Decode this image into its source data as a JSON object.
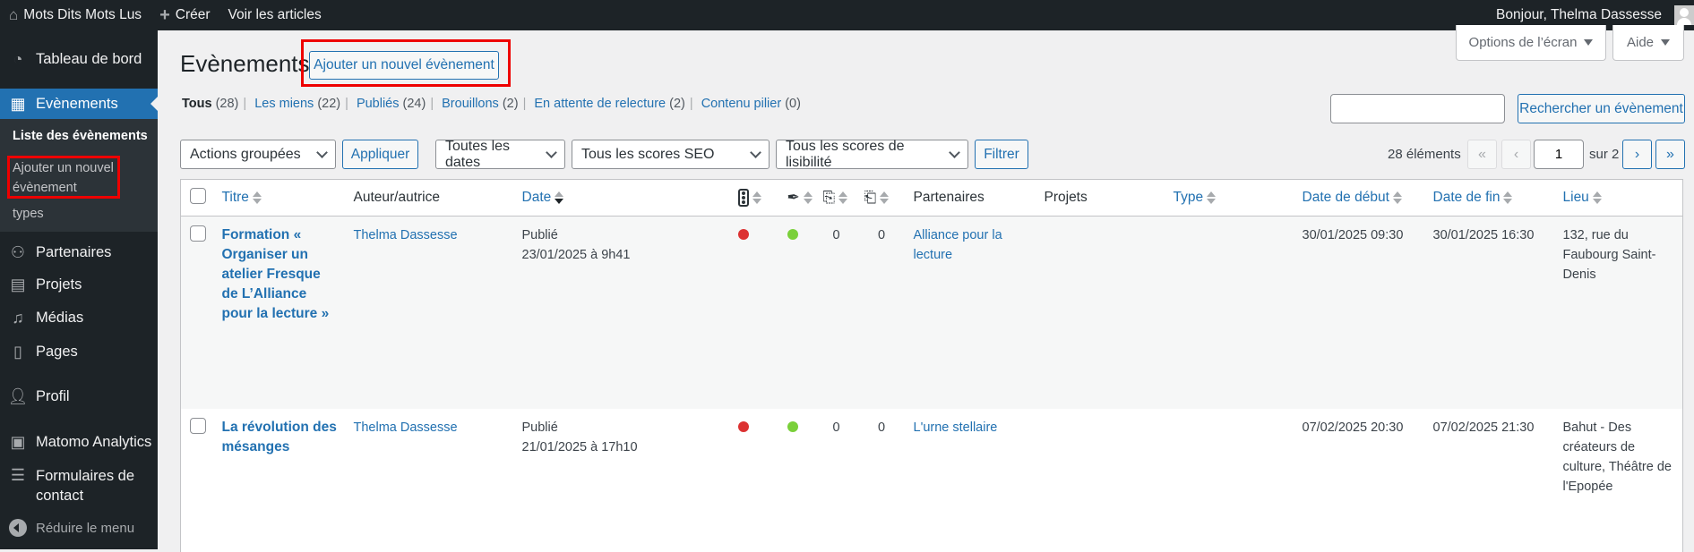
{
  "adminbar": {
    "site_name": "Mots Dits Mots Lus",
    "create": "Créer",
    "view_posts": "Voir les articles",
    "greeting": "Bonjour, Thelma Dassesse"
  },
  "sidebar": {
    "items": [
      {
        "label": "Tableau de bord",
        "icon": "dashboard-icon"
      },
      {
        "label": "Evènements",
        "icon": "calendar-icon",
        "active": true
      },
      {
        "label": "Partenaires",
        "icon": "sitemap-icon"
      },
      {
        "label": "Projets",
        "icon": "grid-icon"
      },
      {
        "label": "Médias",
        "icon": "media-icon"
      },
      {
        "label": "Pages",
        "icon": "pages-icon"
      },
      {
        "label": "Profil",
        "icon": "user-icon"
      },
      {
        "label": "Matomo Analytics",
        "icon": "analytics-icon"
      },
      {
        "label": "Formulaires de contact",
        "icon": "forms-icon"
      }
    ],
    "submenu": [
      "Liste des évènements",
      "Ajouter un nouvel évènement",
      "types"
    ],
    "collapse": "Réduire le menu"
  },
  "screen_options": "Options de l’écran",
  "help": "Aide",
  "page_title": "Evènements",
  "add_new": "Ajouter un nouvel évènement",
  "views": [
    {
      "label": "Tous",
      "count": "(28)",
      "current": true
    },
    {
      "label": "Les miens",
      "count": "(22)"
    },
    {
      "label": "Publiés",
      "count": "(24)"
    },
    {
      "label": "Brouillons",
      "count": "(2)"
    },
    {
      "label": "En attente de relecture",
      "count": "(2)"
    },
    {
      "label": "Contenu pilier",
      "count": "(0)"
    }
  ],
  "search": {
    "value": "",
    "button": "Rechercher un évènement"
  },
  "filters": {
    "bulk": "Actions groupées",
    "apply": "Appliquer",
    "dates": "Toutes les dates",
    "seo": "Tous les scores SEO",
    "readability": "Tous les scores de lisibilité",
    "filter": "Filtrer"
  },
  "pagination": {
    "count": "28 éléments",
    "first": "«",
    "prev": "‹",
    "page": "1",
    "of": "sur 2",
    "next": "›",
    "last": "»"
  },
  "columns": {
    "title": "Titre",
    "author": "Auteur/autrice",
    "date": "Date",
    "partners": "Partenaires",
    "projects": "Projets",
    "type": "Type",
    "start": "Date de début",
    "end": "Date de fin",
    "place": "Lieu"
  },
  "rows": [
    {
      "title": "Formation « Organiser un atelier Fresque de L’Alliance pour la lecture »",
      "author": "Thelma Dassesse",
      "status": "Publié",
      "date": "23/01/2025 à 9h41",
      "seo_color": "#dc3232",
      "read_color": "#7ad03a",
      "links_in": "0",
      "links_out": "0",
      "partners": "Alliance pour la lecture",
      "projects": "",
      "type": "",
      "start": "30/01/2025 09:30",
      "end": "30/01/2025 16:30",
      "place": "132, rue du Faubourg Saint-Denis"
    },
    {
      "title": "La révolution des mésanges",
      "author": "Thelma Dassesse",
      "status": "Publié",
      "date": "21/01/2025 à 17h10",
      "seo_color": "#dc3232",
      "read_color": "#7ad03a",
      "links_in": "0",
      "links_out": "0",
      "partners": "L'urne stellaire",
      "projects": "",
      "type": "",
      "start": "07/02/2025 20:30",
      "end": "07/02/2025 21:30",
      "place": "Bahut - Des créateurs de culture, Théâtre de l'Epopée"
    }
  ]
}
